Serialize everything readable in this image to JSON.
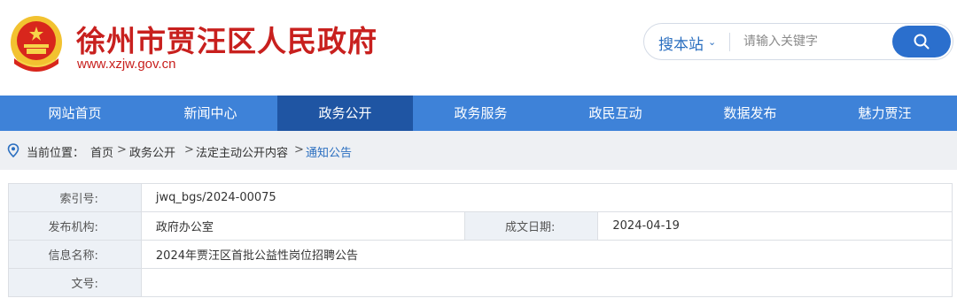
{
  "header": {
    "title": "徐州市贾汪区人民政府",
    "url": "www.xzjw.gov.cn",
    "brand_color": "#c8201e"
  },
  "search": {
    "scope_label": "搜本站",
    "placeholder": "请输入关键字",
    "button_icon": "search-icon"
  },
  "nav": {
    "items": [
      "网站首页",
      "新闻中心",
      "政务公开",
      "政务服务",
      "政民互动",
      "数据发布",
      "魅力贾汪"
    ],
    "active_index": 2,
    "bar_color": "#3e82d8",
    "active_color": "#1f55a3"
  },
  "breadcrumb": {
    "icon": "location-pin-icon",
    "prefix": "当前位置：",
    "items": [
      "首页",
      "政务公开",
      "法定主动公开内容",
      "通知公告"
    ],
    "separator": ">"
  },
  "info": {
    "index_label": "索引号:",
    "index_value": "jwq_bgs/2024-00075",
    "publisher_label": "发布机构:",
    "publisher_value": "政府办公室",
    "date_label": "成文日期:",
    "date_value": "2024-04-19",
    "name_label": "信息名称:",
    "name_value": "2024年贾汪区首批公益性岗位招聘公告",
    "doc_no_label": "文号:",
    "doc_no_value": ""
  }
}
